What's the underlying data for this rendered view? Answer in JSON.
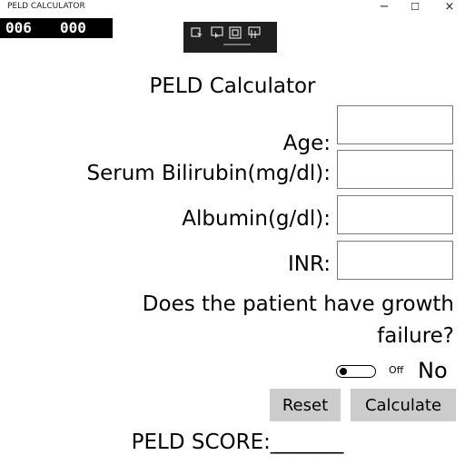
{
  "window": {
    "title": "PELD CALCULATOR",
    "minimize_glyph": "−",
    "maximize_glyph": "☐",
    "close_glyph": "×"
  },
  "counter": {
    "left": "006",
    "right": "000"
  },
  "debug_toolbar": {
    "icons": [
      "select-element-icon",
      "pointer-icon",
      "frame-icon",
      "track-focus-icon"
    ]
  },
  "form": {
    "heading": "PELD Calculator",
    "age_label": "Age:",
    "age_value": "",
    "bilirubin_label": "Serum Bilirubin(mg/dl):",
    "bilirubin_value": "",
    "albumin_label": "Albumin(g/dl):",
    "albumin_value": "",
    "inr_label": "INR:",
    "inr_value": "",
    "growth_question_line1": "Does the patient have growth",
    "growth_question_line2": "failure?",
    "toggle_state": "Off",
    "toggle_answer": "No",
    "reset_label": "Reset",
    "calculate_label": "Calculate",
    "score_label": "PELD SCORE:_______"
  }
}
